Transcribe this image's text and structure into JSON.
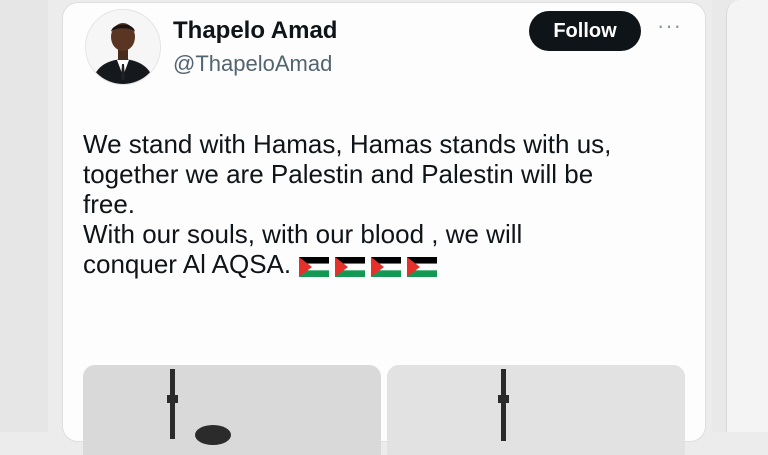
{
  "tweet": {
    "author_name": "Thapelo Amad",
    "author_handle": "@ThapeloAmad",
    "follow_label": "Follow",
    "more_label": "···",
    "text_lines": [
      "We stand with Hamas, Hamas stands with us,",
      "together we are Palestin and Palestin will be",
      "free.",
      "With our souls, with our blood , we will",
      "conquer Al AQSA."
    ],
    "flag_emoji": [
      "palestine-flag",
      "palestine-flag",
      "palestine-flag",
      "palestine-flag"
    ],
    "media_count": 2
  },
  "colors": {
    "text": "#0f1419",
    "secondary": "#536471",
    "follow_bg": "#0f1419",
    "flag_black": "#000000",
    "flag_white": "#ffffff",
    "flag_green": "#149954",
    "flag_red": "#e4312b"
  }
}
